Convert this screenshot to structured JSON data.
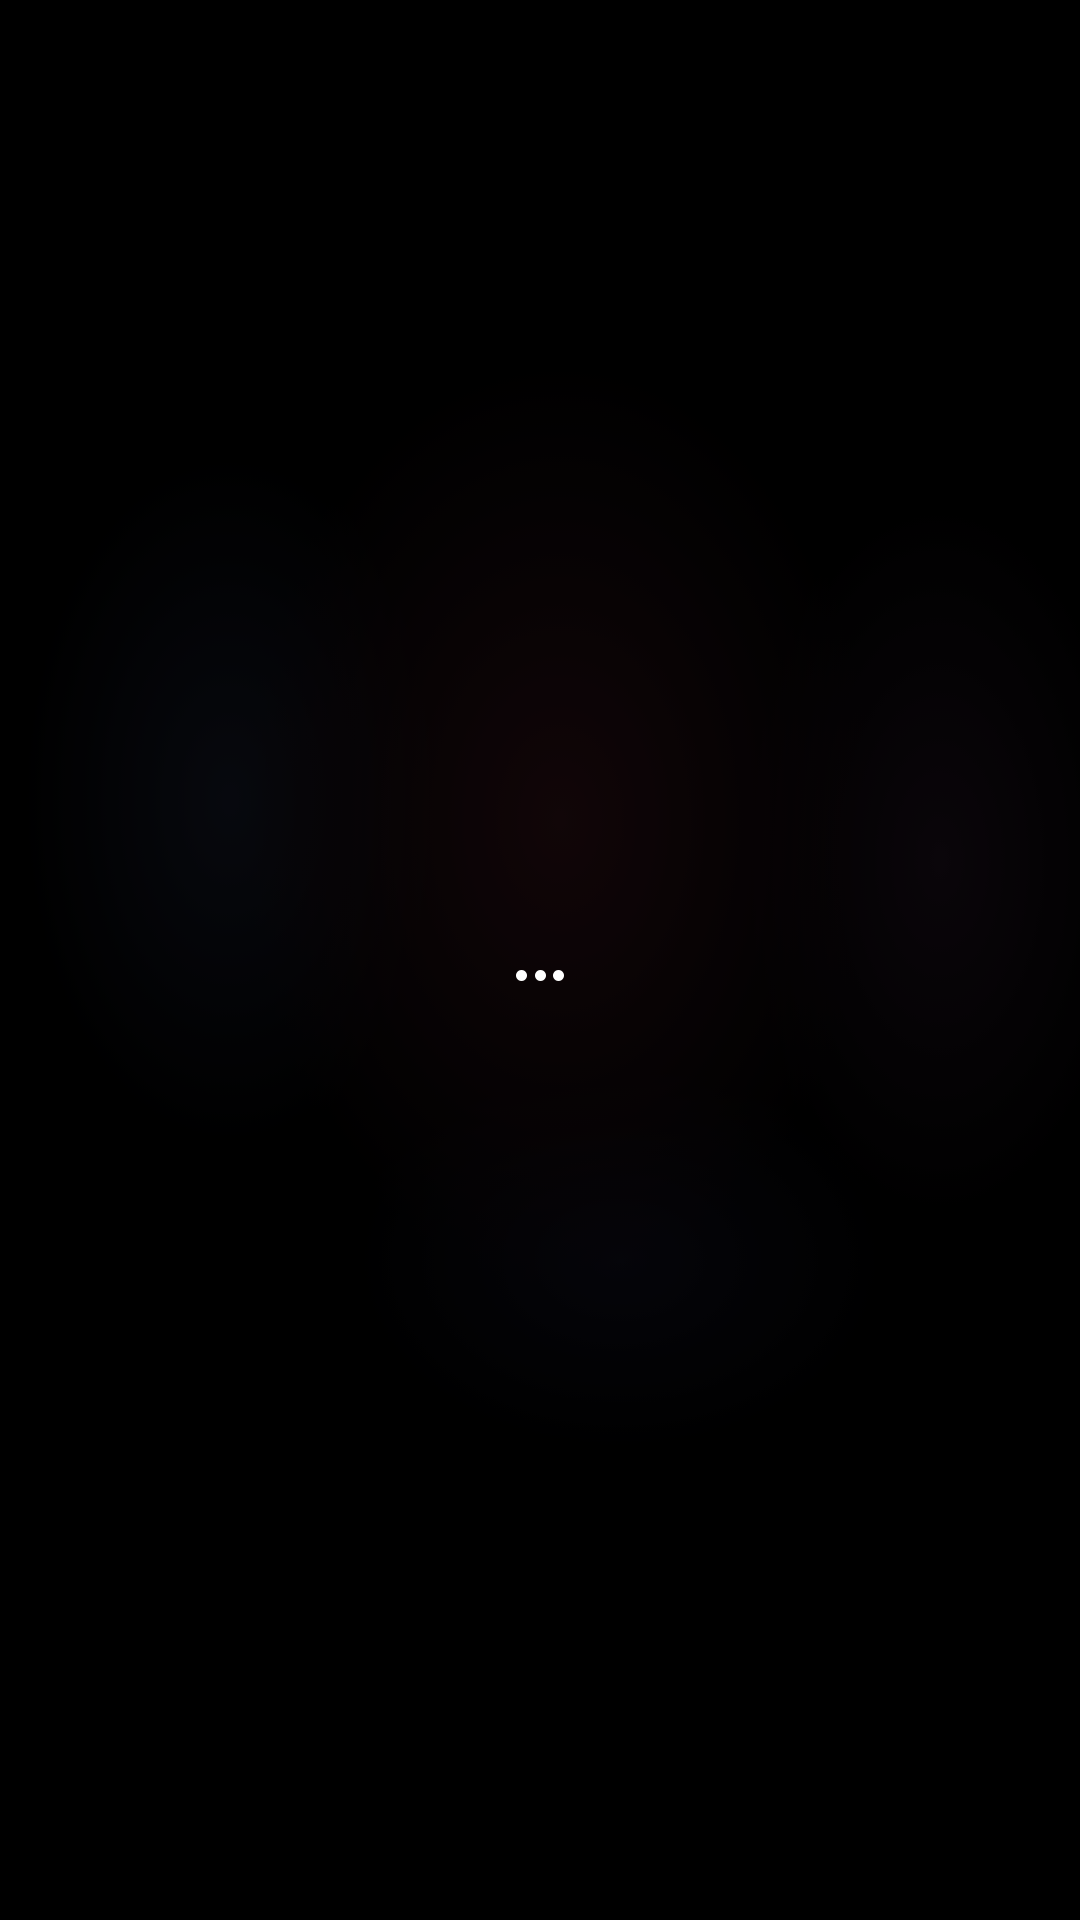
{
  "screen": {
    "background_color": "#000000",
    "state": "loading"
  },
  "loading_indicator": {
    "icon": "loading-dots-icon",
    "dot_count": 3,
    "dot_color": "#ffffff"
  }
}
